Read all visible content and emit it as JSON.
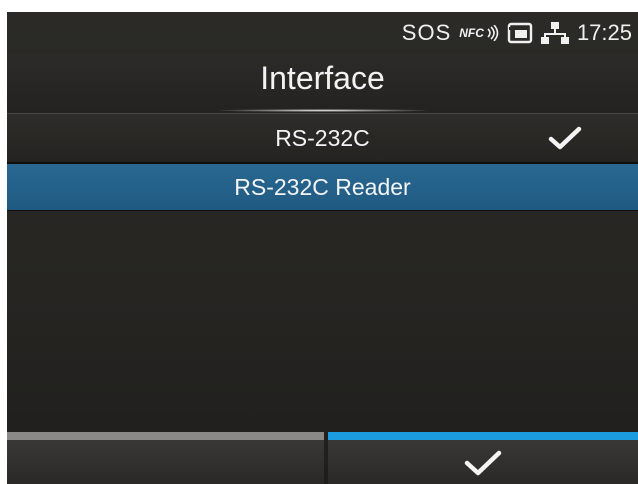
{
  "status_bar": {
    "sos_label": "SOS",
    "nfc_label": "NFC",
    "time": "17:25",
    "icons": [
      "nfc-icon",
      "memory-card-icon",
      "network-icon"
    ]
  },
  "header": {
    "title": "Interface"
  },
  "list": {
    "items": [
      {
        "label": "RS-232C",
        "checked": true,
        "selected": false
      },
      {
        "label": "RS-232C Reader",
        "checked": false,
        "selected": true
      }
    ]
  },
  "softkeys": {
    "left": {
      "icon": "none"
    },
    "right": {
      "icon": "checkmark-icon"
    }
  },
  "colors": {
    "background": "#262522",
    "selection": "#2165 8d",
    "softkey_active": "#1c9ce0",
    "softkey_inactive": "#8a8987"
  }
}
